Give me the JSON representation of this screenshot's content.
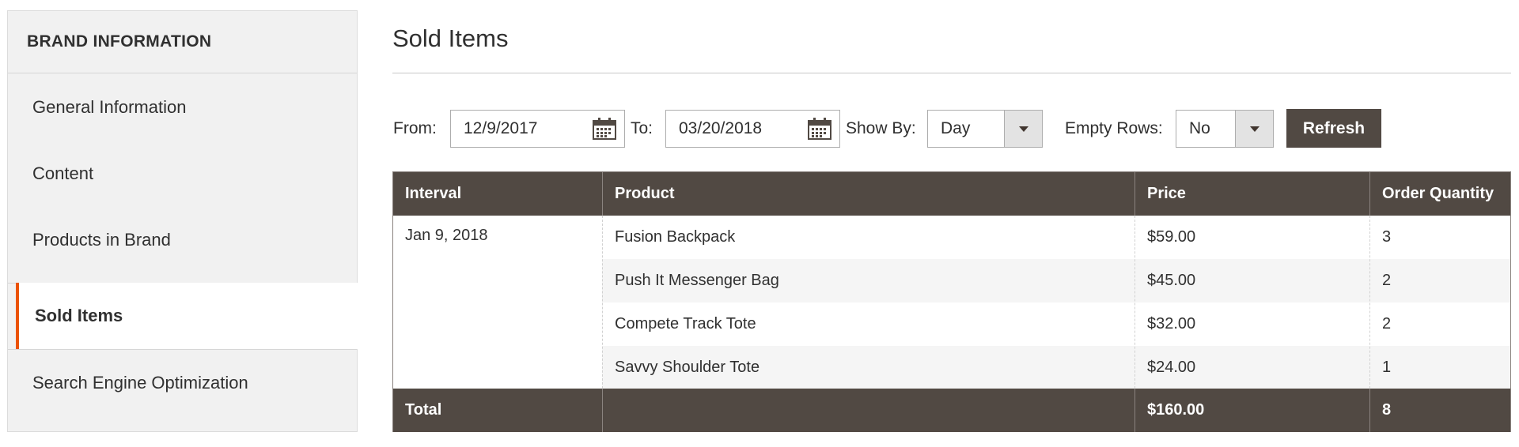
{
  "sidebar": {
    "title": "BRAND INFORMATION",
    "items": [
      {
        "label": "General Information"
      },
      {
        "label": "Content"
      },
      {
        "label": "Products in Brand"
      },
      {
        "label": "Sold Items"
      },
      {
        "label": "Search Engine Optimization"
      }
    ],
    "active_item": "Sold Items"
  },
  "main": {
    "title": "Sold Items",
    "filters": {
      "from_label": "From:",
      "from_value": "12/9/2017",
      "to_label": "To:",
      "to_value": "03/20/2018",
      "show_by_label": "Show By:",
      "show_by_value": "Day",
      "empty_rows_label": "Empty Rows:",
      "empty_rows_value": "No",
      "refresh_label": "Refresh"
    },
    "table": {
      "columns": [
        "Interval",
        "Product",
        "Price",
        "Order Quantity"
      ],
      "interval": "Jan 9, 2018",
      "rows": [
        {
          "product": "Fusion Backpack",
          "price": "$59.00",
          "qty": "3"
        },
        {
          "product": "Push It Messenger Bag",
          "price": "$45.00",
          "qty": "2"
        },
        {
          "product": "Compete Track Tote",
          "price": "$32.00",
          "qty": "2"
        },
        {
          "product": "Savvy Shoulder Tote",
          "price": "$24.00",
          "qty": "1"
        }
      ],
      "totals": {
        "label": "Total",
        "price": "$160.00",
        "qty": "8"
      }
    }
  },
  "colors": {
    "accent": "#eb5202",
    "header_bg": "#514943",
    "sidebar_bg": "#f1f1f1"
  }
}
